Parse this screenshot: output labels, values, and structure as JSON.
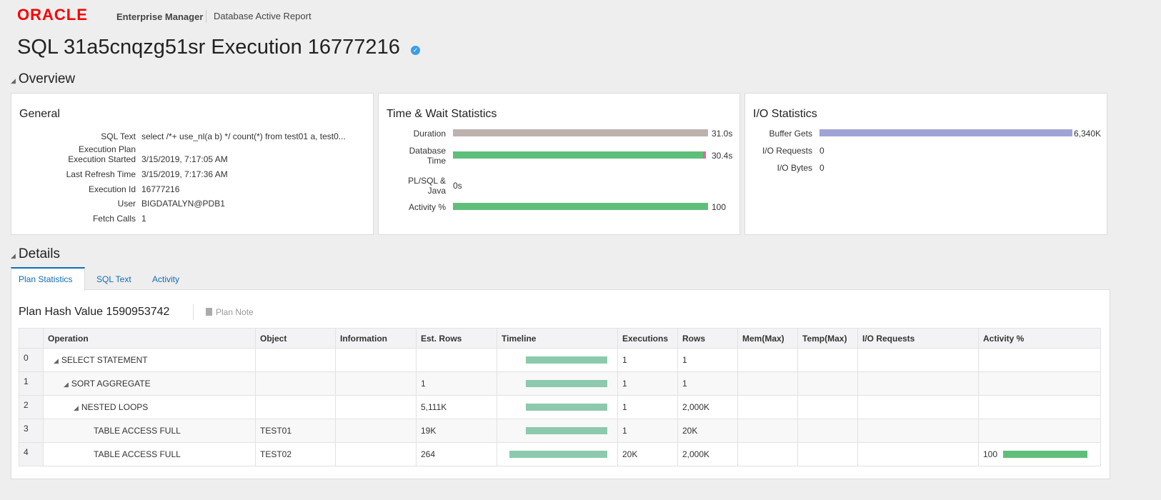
{
  "header": {
    "brand": "ORACLE",
    "product": "Enterprise Manager",
    "report": "Database Active Report"
  },
  "page_title": "SQL 31a5cnqzg51sr Execution 16777216",
  "overview": {
    "label": "Overview",
    "general": {
      "title": "General",
      "fields": [
        {
          "label": "SQL Text",
          "value": "select /*+ use_nl(a b) */ count(*) from test01 a, test0..."
        },
        {
          "label": "Execution Plan",
          "value": ""
        },
        {
          "label": "Execution Started",
          "value": "3/15/2019, 7:17:05 AM"
        },
        {
          "label": "Last Refresh Time",
          "value": "3/15/2019, 7:17:36 AM"
        },
        {
          "label": "Execution Id",
          "value": "16777216"
        },
        {
          "label": "User",
          "value": "BIGDATALYN@PDB1"
        },
        {
          "label": "Fetch Calls",
          "value": "1"
        }
      ]
    },
    "time": {
      "title": "Time & Wait Statistics",
      "rows": [
        {
          "label": "Duration",
          "value": "31.0s",
          "fraction": 1.0,
          "color": "#bdb2ae"
        },
        {
          "label": "Database Time",
          "value": "30.4s",
          "fraction": 0.98,
          "color": "#5fbf7a"
        },
        {
          "label": "PL/SQL & Java",
          "value": "0s",
          "fraction": 0
        },
        {
          "label": "Activity %",
          "value": "100",
          "fraction": 1.0,
          "color": "#5fbf7a"
        }
      ]
    },
    "io": {
      "title": "I/O Statistics",
      "rows": [
        {
          "label": "Buffer Gets",
          "value": "6,340K",
          "fraction": 1.0,
          "color": "#a0a3d6"
        },
        {
          "label": "I/O Requests",
          "value": "0"
        },
        {
          "label": "I/O Bytes",
          "value": "0"
        }
      ]
    }
  },
  "details": {
    "label": "Details",
    "tabs": [
      "Plan Statistics",
      "SQL Text",
      "Activity"
    ],
    "plan_hash": "Plan Hash Value 1590953742",
    "plan_note": "Plan Note",
    "columns": [
      "Operation",
      "Object",
      "Information",
      "Est. Rows",
      "Timeline",
      "Executions",
      "Rows",
      "Mem(Max)",
      "Temp(Max)",
      "I/O Requests",
      "Activity %"
    ],
    "rows": [
      {
        "id": "0",
        "op": "SELECT STATEMENT",
        "indent": 0,
        "obj": "",
        "info": "",
        "est": "",
        "tl": [
          0.22,
          0.95
        ],
        "exec": "1",
        "rows": "1",
        "act": ""
      },
      {
        "id": "1",
        "op": "SORT AGGREGATE",
        "indent": 1,
        "obj": "",
        "info": "",
        "est": "1",
        "tl": [
          0.22,
          0.95
        ],
        "exec": "1",
        "rows": "1",
        "act": ""
      },
      {
        "id": "2",
        "op": "NESTED LOOPS",
        "indent": 2,
        "obj": "",
        "info": "",
        "est": "5,111K",
        "tl": [
          0.22,
          0.95
        ],
        "exec": "1",
        "rows": "2,000K",
        "act": ""
      },
      {
        "id": "3",
        "op": "TABLE ACCESS FULL",
        "indent": 3,
        "obj": "TEST01",
        "info": "",
        "est": "19K",
        "tl": [
          0.22,
          0.95
        ],
        "exec": "1",
        "rows": "20K",
        "act": ""
      },
      {
        "id": "4",
        "op": "TABLE ACCESS FULL",
        "indent": 3,
        "obj": "TEST02",
        "info": "",
        "est": "264",
        "tl": [
          0.07,
          0.95
        ],
        "exec": "20K",
        "rows": "2,000K",
        "act": "100",
        "act_fraction": 1.0
      }
    ]
  }
}
